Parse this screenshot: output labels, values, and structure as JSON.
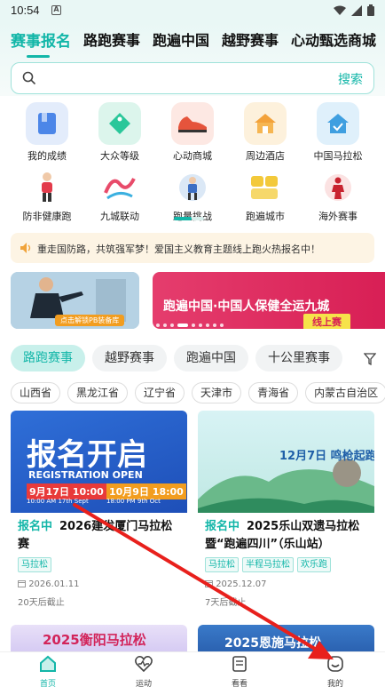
{
  "status_bar": {
    "time": "10:54",
    "badge": "A"
  },
  "top_tabs": [
    "赛事报名",
    "路跑赛事",
    "跑遍中国",
    "越野赛事",
    "心动甄选商城"
  ],
  "search": {
    "placeholder": "",
    "button": "搜索"
  },
  "quick_grid": [
    {
      "label": "我的成绩",
      "icon": "book-icon"
    },
    {
      "label": "大众等级",
      "icon": "tag-icon"
    },
    {
      "label": "心动商城",
      "icon": "sneaker-icon"
    },
    {
      "label": "周边酒店",
      "icon": "house-icon"
    },
    {
      "label": "中国马拉松",
      "icon": "home-check-icon"
    },
    {
      "label": "防非健康跑",
      "icon": "runner-icon"
    },
    {
      "label": "九城联动",
      "icon": "jiucheng-logo-icon"
    },
    {
      "label": "跑量挑战",
      "icon": "challenge-runner-icon"
    },
    {
      "label": "跑遍城市",
      "icon": "city-run-logo-icon"
    },
    {
      "label": "海外赛事",
      "icon": "overseas-runner-icon"
    }
  ],
  "notice": {
    "text": "重走国防路，共筑强军梦！爱国主义教育主题线上跑火热报名中！"
  },
  "banners": {
    "left_tag": "点击解锁PB装备库",
    "right_title": "跑遍中国·中国人保健全运九城",
    "right_sub": "线上赛"
  },
  "category_tabs": [
    "路跑赛事",
    "越野赛事",
    "跑遍中国",
    "十公里赛事"
  ],
  "provinces": [
    "山西省",
    "黑龙江省",
    "辽宁省",
    "天津市",
    "青海省",
    "内蒙古自治区"
  ],
  "events": [
    {
      "status": "报名中",
      "title": "2026建发厦门马拉松赛",
      "tags": [
        "马拉松"
      ],
      "date": "2026.01.11",
      "deadline": "20天后截止",
      "poster_main": "报名开启",
      "poster_sub": "REGISTRATION OPEN",
      "poster_dates": [
        "9月17日 10:00",
        "10月9日 18:00"
      ],
      "poster_dates_en": [
        "10:00 AM 17th Sept",
        "18:00 PM 9th Oct"
      ]
    },
    {
      "status": "报名中",
      "title": "2025乐山双遗马拉松暨“跑遍四川”（乐山站）",
      "tags": [
        "马拉松",
        "半程马拉松",
        "欢乐跑"
      ],
      "date": "2025.12.07",
      "deadline": "7天后截止",
      "poster_main": "12月7日 鸣枪起跑"
    }
  ],
  "peek_titles": [
    "2025衡阳马拉松",
    "2025恩施马拉松"
  ],
  "bottom_nav": [
    {
      "label": "首页",
      "icon": "home-icon",
      "active": true
    },
    {
      "label": "运动",
      "icon": "heart-pulse-icon",
      "active": false
    },
    {
      "label": "看看",
      "icon": "news-icon",
      "active": false
    },
    {
      "label": "我的",
      "icon": "smile-face-icon",
      "active": false
    }
  ],
  "colors": {
    "accent": "#12b6a8",
    "arrow": "#e8201c",
    "notice_bg": "#fdf4e4"
  }
}
